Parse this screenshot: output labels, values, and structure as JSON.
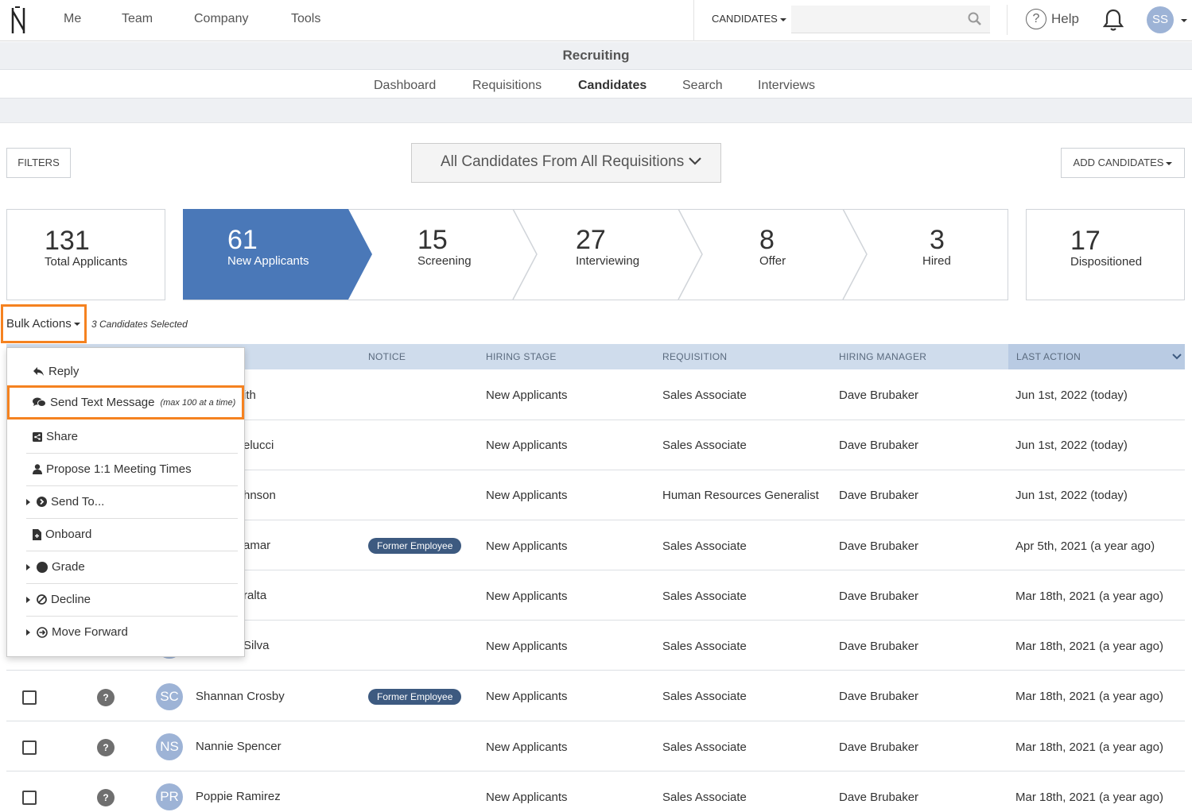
{
  "topnav": {
    "links": [
      "Me",
      "Team",
      "Company",
      "Tools"
    ],
    "search_scope": "CANDIDATES",
    "search_value": "",
    "help_label": "Help",
    "user_initials": "SS"
  },
  "section": {
    "title": "Recruiting",
    "tabs": [
      "Dashboard",
      "Requisitions",
      "Candidates",
      "Search",
      "Interviews"
    ],
    "active_tab": "Candidates"
  },
  "controls": {
    "filters_label": "FILTERS",
    "requisition_select": "All Candidates From All Requisitions",
    "add_candidates_label": "ADD CANDIDATES"
  },
  "pipeline": {
    "total": {
      "count": "131",
      "label": "Total Applicants"
    },
    "stages": [
      {
        "count": "61",
        "label": "New Applicants",
        "active": true
      },
      {
        "count": "15",
        "label": "Screening"
      },
      {
        "count": "27",
        "label": "Interviewing"
      },
      {
        "count": "8",
        "label": "Offer"
      },
      {
        "count": "3",
        "label": "Hired"
      }
    ],
    "dispositioned": {
      "count": "17",
      "label": "Dispositioned"
    },
    "active_color": "#4a78b8"
  },
  "bulk": {
    "label": "Bulk Actions",
    "selected_note": "3 Candidates Selected",
    "highlight_color": "#f58220"
  },
  "menu": {
    "reply": "Reply",
    "send_text": "Send Text Message",
    "send_text_note": "(max 100 at a time)",
    "share": "Share",
    "propose": "Propose 1:1 Meeting Times",
    "send_to": "Send To...",
    "onboard": "Onboard",
    "grade": "Grade",
    "decline": "Decline",
    "move_forward": "Move Forward"
  },
  "table": {
    "headers": {
      "notice": "NOTICE",
      "stage": "HIRING STAGE",
      "requisition": "REQUISITION",
      "manager": "HIRING MANAGER",
      "last_action": "LAST ACTION"
    },
    "rows": [
      {
        "initials": "",
        "name": "ith",
        "notice": "",
        "stage": "New Applicants",
        "requisition": "Sales Associate",
        "manager": "Dave Brubaker",
        "last_action": "Jun 1st, 2022 (today)"
      },
      {
        "initials": "",
        "name": "elucci",
        "notice": "",
        "stage": "New Applicants",
        "requisition": "Sales Associate",
        "manager": "Dave Brubaker",
        "last_action": "Jun 1st, 2022 (today)"
      },
      {
        "initials": "",
        "name": "hnson",
        "notice": "",
        "stage": "New Applicants",
        "requisition": "Human Resources Generalist",
        "manager": "Dave Brubaker",
        "last_action": "Jun 1st, 2022 (today)"
      },
      {
        "initials": "",
        "name": "amar",
        "notice": "Former Employee",
        "stage": "New Applicants",
        "requisition": "Sales Associate",
        "manager": "Dave Brubaker",
        "last_action": "Apr 5th, 2021 (a year ago)"
      },
      {
        "initials": "",
        "name": "ralta",
        "notice": "",
        "stage": "New Applicants",
        "requisition": "Sales Associate",
        "manager": "Dave Brubaker",
        "last_action": "Mar 18th, 2021 (a year ago)"
      },
      {
        "initials": "",
        "name": "Silva",
        "notice": "",
        "stage": "New Applicants",
        "requisition": "Sales Associate",
        "manager": "Dave Brubaker",
        "last_action": "Mar 18th, 2021 (a year ago)"
      },
      {
        "initials": "SC",
        "name": "Shannan Crosby",
        "notice": "Former Employee",
        "stage": "New Applicants",
        "requisition": "Sales Associate",
        "manager": "Dave Brubaker",
        "last_action": "Mar 18th, 2021 (a year ago)"
      },
      {
        "initials": "NS",
        "name": "Nannie Spencer",
        "notice": "",
        "stage": "New Applicants",
        "requisition": "Sales Associate",
        "manager": "Dave Brubaker",
        "last_action": "Mar 18th, 2021 (a year ago)"
      },
      {
        "initials": "PR",
        "name": "Poppie Ramirez",
        "notice": "",
        "stage": "New Applicants",
        "requisition": "Sales Associate",
        "manager": "Dave Brubaker",
        "last_action": "Mar 18th, 2021 (a year ago)"
      }
    ]
  }
}
